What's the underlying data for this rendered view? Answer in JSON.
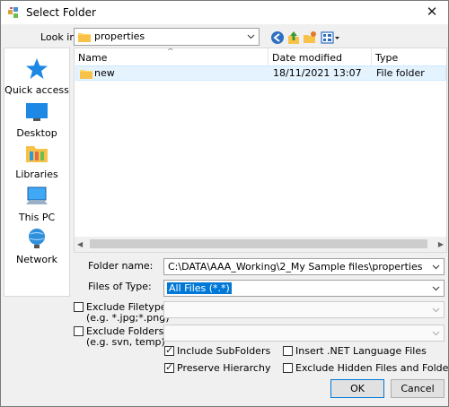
{
  "window": {
    "title": "Select Folder",
    "close_glyph": "✕"
  },
  "lookin": {
    "label": "Look in:",
    "value": "properties"
  },
  "toolbar": {
    "icons": [
      "back-icon",
      "up-folder-icon",
      "new-folder-icon",
      "view-menu-icon"
    ]
  },
  "places": [
    {
      "label": "Quick access",
      "icon": "quick-access-star-icon"
    },
    {
      "label": "Desktop",
      "icon": "desktop-icon"
    },
    {
      "label": "Libraries",
      "icon": "libraries-icon"
    },
    {
      "label": "This PC",
      "icon": "this-pc-icon"
    },
    {
      "label": "Network",
      "icon": "network-icon"
    }
  ],
  "filelist": {
    "columns": [
      "Name",
      "Date modified",
      "Type"
    ],
    "rows": [
      {
        "name": "new",
        "date": "18/11/2021 13:07",
        "type": "File folder"
      }
    ]
  },
  "form": {
    "folder_name_label": "Folder name:",
    "folder_name_value": "C:\\DATA\\AAA_Working\\2_My Sample files\\properties",
    "files_of_type_label": "Files of Type:",
    "files_of_type_value": "All Files (*.*)",
    "exclude_filetypes_label": "Exclude Filetypes:",
    "exclude_filetypes_hint": "(e.g. *.jpg;*.png)",
    "exclude_folders_label": "Exclude Folders:",
    "exclude_folders_hint": "(e.g. svn, temp)"
  },
  "options": {
    "include_subfolders": {
      "label": "Include SubFolders",
      "checked": true
    },
    "preserve_hierarchy": {
      "label": "Preserve Hierarchy",
      "checked": true
    },
    "insert_net_files": {
      "label": "Insert .NET Language Files",
      "checked": false
    },
    "exclude_hidden": {
      "label": "Exclude Hidden Files and Folders",
      "checked": false
    }
  },
  "buttons": {
    "ok": "OK",
    "cancel": "Cancel"
  },
  "colors": {
    "selection": "#e5f3ff",
    "accent": "#0078d7",
    "highlight": "#0078d7"
  }
}
